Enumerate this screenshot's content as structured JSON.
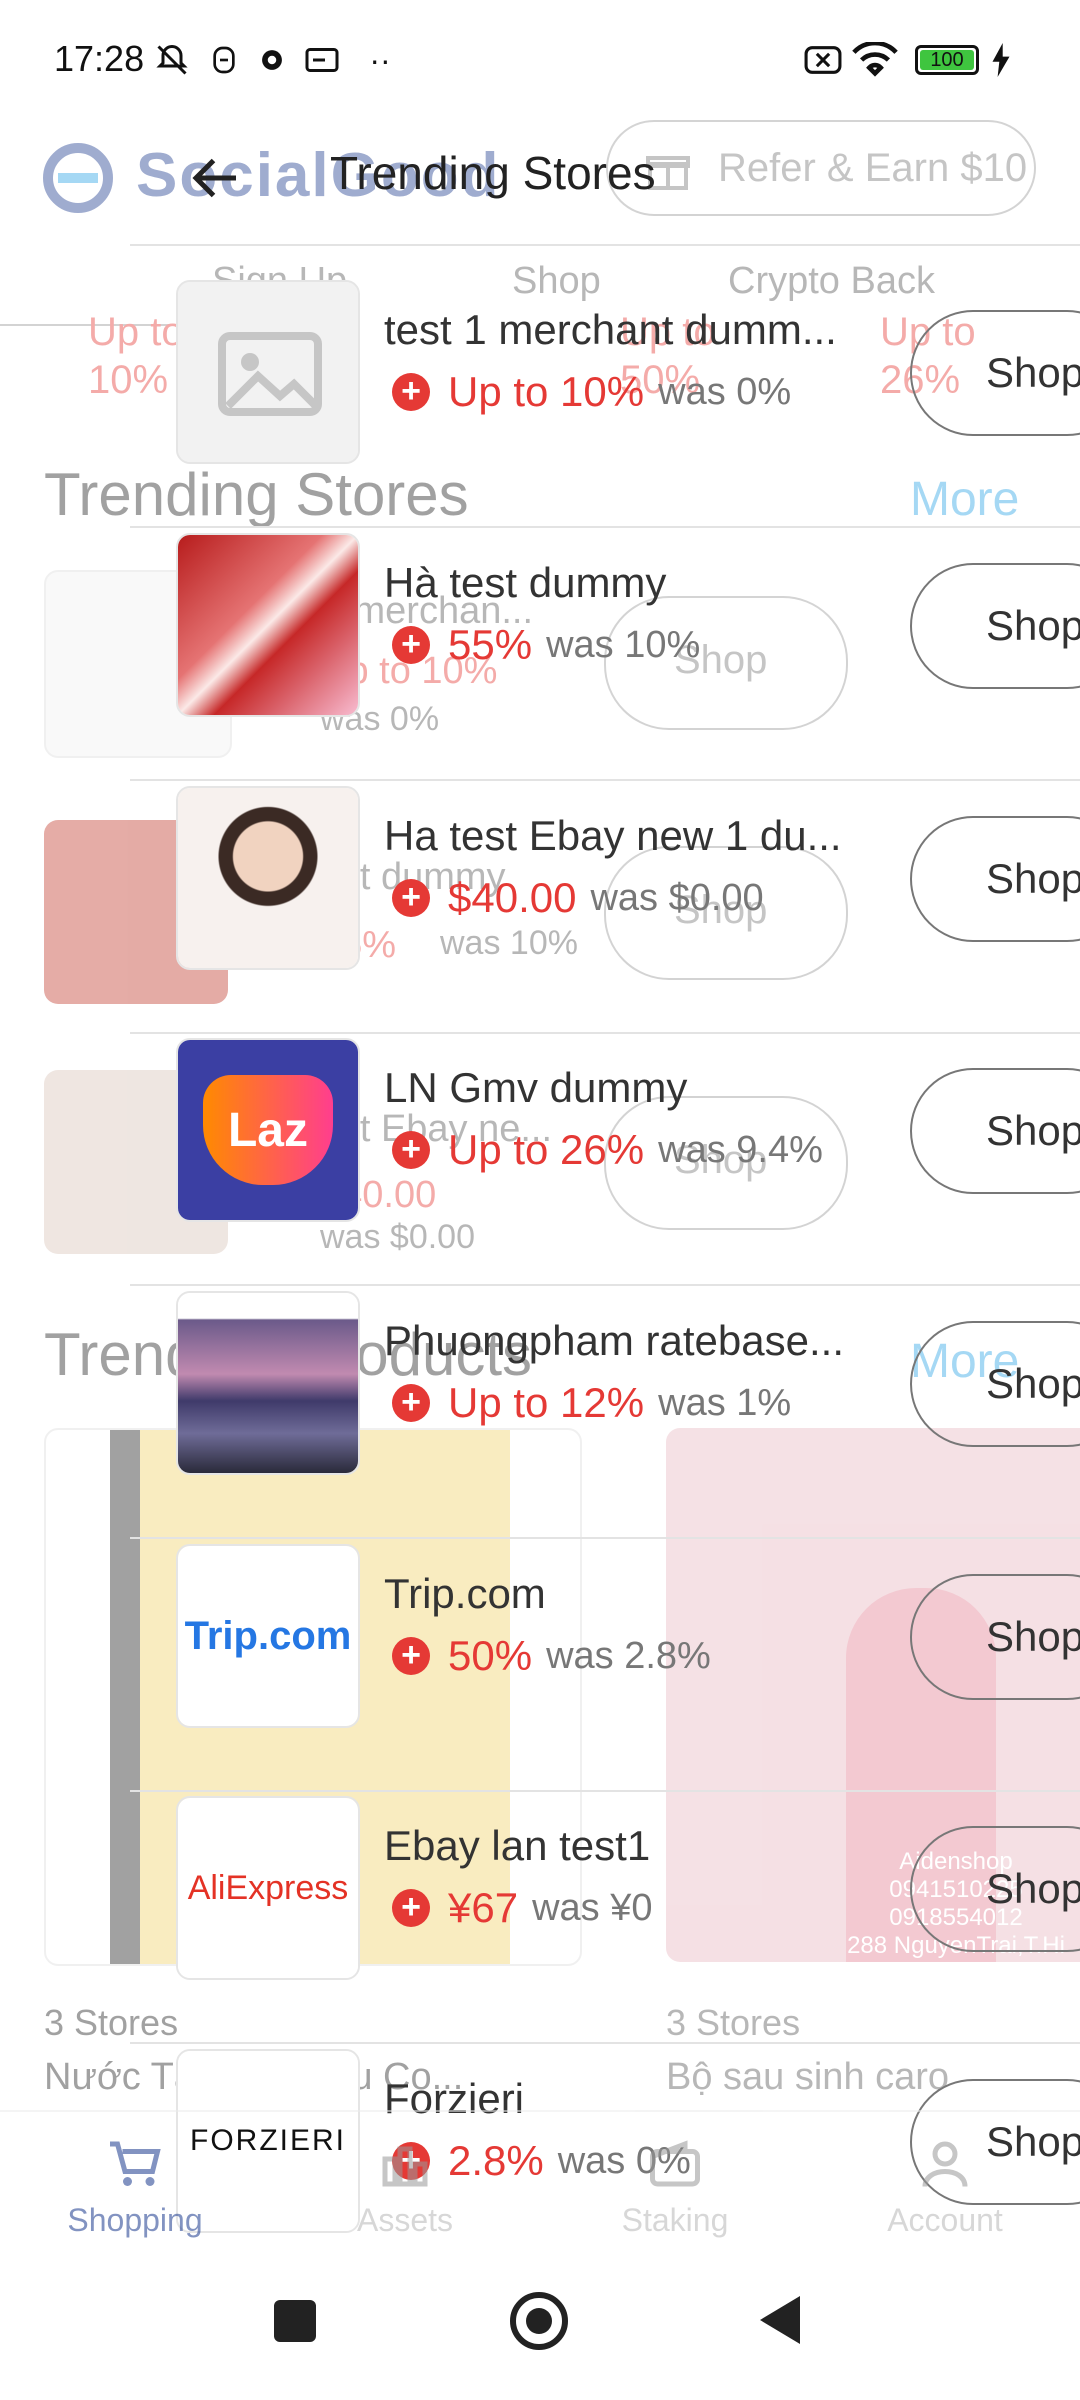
{
  "status_bar": {
    "time": "17:28",
    "icons": [
      "mute-bell-icon",
      "face-icon",
      "gear-icon",
      "card-icon",
      "more-dots-icon"
    ],
    "right_icons": [
      "sim-x-icon",
      "wifi-icon",
      "battery-icon",
      "charging-icon"
    ],
    "battery": "100"
  },
  "background_page": {
    "brand": "SocialGood",
    "refer": "Refer & Earn $10",
    "tabs": [
      "Sign Up",
      "Shop",
      "Crypto Back"
    ],
    "top_rates": [
      "Up to 10%",
      "Up to 50%",
      "Up to 26%"
    ],
    "trending_stores_title": "Trending Stores",
    "more_label": "More",
    "bg_store_1": {
      "name": "test 1 merchan...",
      "rate": "Up to 10%",
      "was": "was 0%",
      "shop": "Shop"
    },
    "bg_store_2": {
      "name": "Ha test dummy",
      "rate": "55%",
      "was": "was 10%",
      "shop": "Shop"
    },
    "bg_store_3": {
      "name": "Ha test Ebay ne...",
      "rate": "$40.00",
      "was": "was $0.00",
      "shop": "Shop"
    },
    "trending_products_title": "Trending Products",
    "product_1": {
      "stores": "3 Stores",
      "name": "Nước Tẩy Bồn Cầu Co..."
    },
    "product_2": {
      "stores": "3 Stores",
      "name": "Bộ sau sinh caro"
    },
    "product_2_watermark": [
      "Aidenshop",
      "0941510225",
      "0918554012",
      "288 NguyenTrai,T.Hi"
    ]
  },
  "header": {
    "title": "Trending Stores",
    "back_icon": "arrow-left-icon"
  },
  "stores": [
    {
      "name": "test 1 merchant dumm...",
      "rate": "Up to 10%",
      "was": "was 0%",
      "thumb": "placeholder",
      "shop_label": "Shop"
    },
    {
      "name": "Hà test dummy",
      "rate": "55%",
      "was": "was 10%",
      "thumb": "lipstick",
      "shop_label": "Shop"
    },
    {
      "name": "Ha test Ebay new 1 du...",
      "rate": "$40.00",
      "was": "was $0.00",
      "thumb": "portrait",
      "shop_label": "Shop"
    },
    {
      "name": "LN Gmv dummy",
      "rate": "Up to 26%",
      "was": "was 9.4%",
      "thumb": "laz",
      "shop_label": "Shop"
    },
    {
      "name": "Phuongpham ratebase...",
      "rate": "Up to 12%",
      "was": "was 1%",
      "thumb": "lake",
      "shop_label": "Shop"
    },
    {
      "name": "Trip.com",
      "rate": "50%",
      "was": "was 2.8%",
      "thumb": "trip",
      "shop_label": "Shop"
    },
    {
      "name": "Ebay lan test1",
      "rate": "¥67",
      "was": "was ¥0",
      "thumb": "aliexpress",
      "shop_label": "Shop"
    },
    {
      "name": "Forzieri",
      "rate": "2.8%",
      "was": "was 0%",
      "thumb": "forzieri",
      "shop_label": "Shop"
    }
  ],
  "logos": {
    "laz": "Laz",
    "trip": "Trip.com",
    "aliexpress": "AliExpress",
    "forzieri": "FORZIERI"
  },
  "bottom_nav": [
    {
      "label": "Shopping",
      "icon": "cart-icon",
      "active": true
    },
    {
      "label": "Assets",
      "icon": "chart-icon",
      "active": false
    },
    {
      "label": "Staking",
      "icon": "wallet-icon",
      "active": false
    },
    {
      "label": "Account",
      "icon": "person-icon",
      "active": false
    }
  ],
  "colors": {
    "accent_red": "#e53935",
    "brand_blue": "#1d3b8f",
    "link_blue": "#2aa3e6",
    "laz_purple": "#3b3fa3"
  }
}
